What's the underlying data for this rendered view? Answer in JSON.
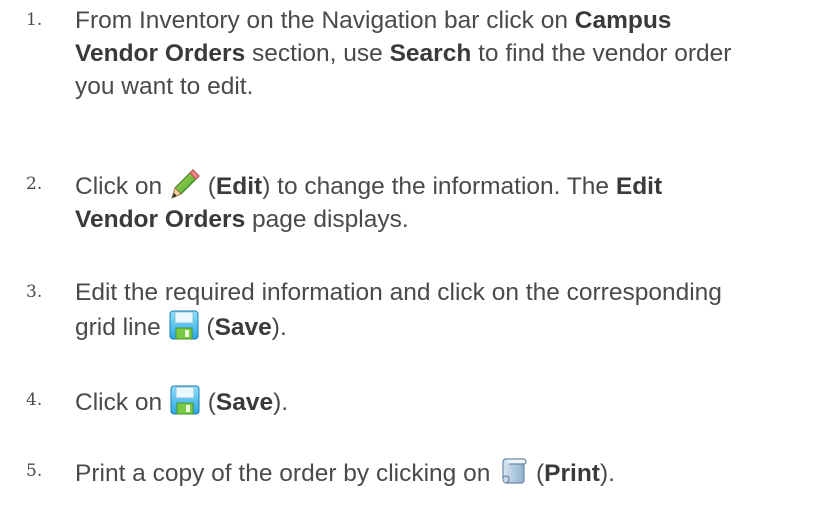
{
  "steps": [
    {
      "number": "1.",
      "line1_a": "From Inventory on the Navigation bar click on ",
      "line1_b": "Campus",
      "line2_a": "Vendor Orders",
      "line2_b": " section, use ",
      "line2_c": "Search",
      "line2_d": " to find the vendor order",
      "line3": "you want to edit."
    },
    {
      "number": "2.",
      "line1_a": "Click on ",
      "line1_b": " (",
      "line1_c": "Edit",
      "line1_d": ") to change the information. The ",
      "line1_e": "Edit",
      "line2_a": "Vendor Orders",
      "line2_b": " page displays.",
      "icon": "pencil-icon"
    },
    {
      "number": "3.",
      "line1": "Edit the required information and click on the corresponding",
      "line2_a": "grid line ",
      "line2_b": " (",
      "line2_c": "Save",
      "line2_d": ").",
      "icon": "floppy-disk-icon"
    },
    {
      "number": "4.",
      "line1_a": "Click on ",
      "line1_b": " (",
      "line1_c": "Save",
      "line1_d": ").",
      "icon": "floppy-disk-icon"
    },
    {
      "number": "5.",
      "line1_a": "Print a copy of the order by clicking on ",
      "line1_b": " (",
      "line1_c": "Print",
      "line1_d": ").",
      "icon": "scroll-icon"
    }
  ]
}
